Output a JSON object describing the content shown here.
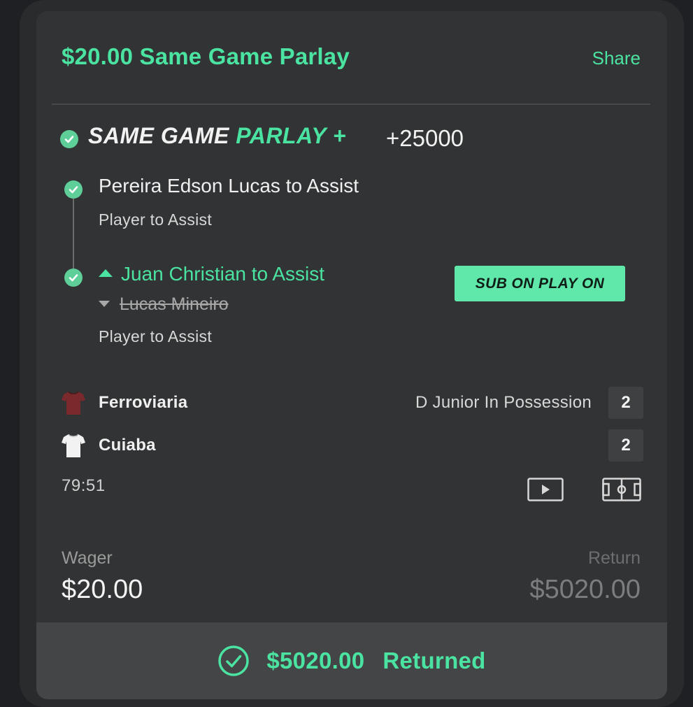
{
  "header": {
    "title": "$20.00 Same Game Parlay",
    "share_label": "Share"
  },
  "parlay": {
    "label_prefix": "SAME GAME ",
    "label_accent": "PARLAY +",
    "odds": "+25000"
  },
  "legs": [
    {
      "title": "Pereira Edson Lucas to Assist",
      "subtitle": "Player to Assist"
    },
    {
      "title": "Juan Christian to Assist",
      "replaced": "Lucas Mineiro",
      "subtitle": "Player to Assist",
      "badge": "SUB ON PLAY ON"
    }
  ],
  "match": {
    "teams": [
      {
        "name": "Ferroviaria",
        "score": "2",
        "jersey_color": "#7a2a2c"
      },
      {
        "name": "Cuiaba",
        "score": "2",
        "jersey_color": "#f2f2f2"
      }
    ],
    "possession": "D Junior In Possession",
    "clock": "79:51"
  },
  "wager": {
    "label": "Wager",
    "amount": "$20.00"
  },
  "return": {
    "label": "Return",
    "amount": "$5020.00"
  },
  "footer": {
    "amount": "$5020.00",
    "status": "Returned"
  },
  "icons": {
    "leg_status": "check-circle-icon",
    "video": "play-video-icon",
    "pitch": "pitch-tracker-icon",
    "footer_status": "check-circle-outline-icon"
  },
  "colors": {
    "accent": "#4be3a1",
    "card_bg": "#323334",
    "footer_bg": "#444546"
  }
}
